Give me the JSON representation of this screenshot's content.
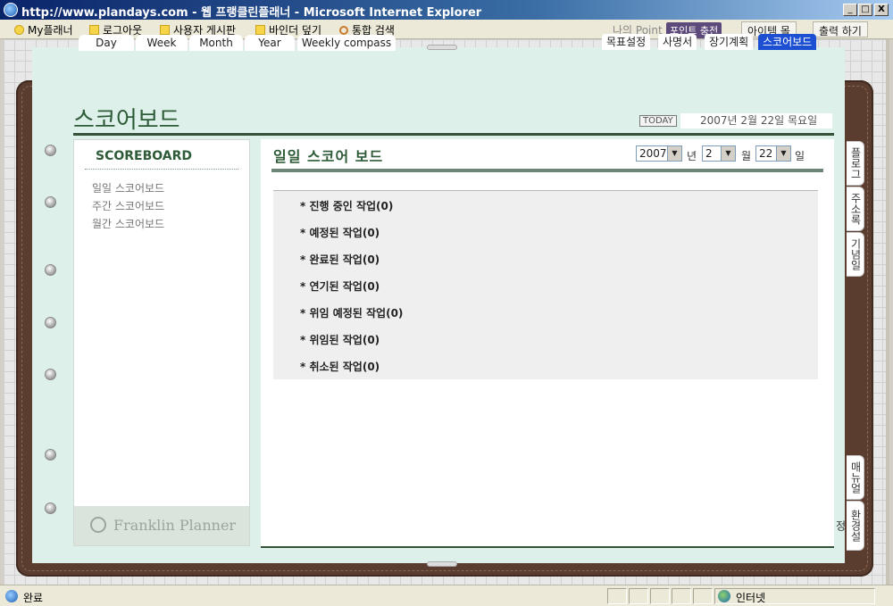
{
  "window": {
    "title": "http://www.plandays.com - 웹 프랭클린플래너 - Microsoft Internet Explorer",
    "minimize": "_",
    "maximize": "□",
    "close": "X"
  },
  "linkbar": {
    "links": [
      "My플래너",
      "로그아웃",
      "사용자 게시판",
      "바인더 덮기",
      "통합 검색"
    ],
    "point_label": "나의 Point",
    "point_charge": "포인트 충전",
    "item_mall": "아이템 몰",
    "print": "출력 하기"
  },
  "top_tabs": [
    "Day",
    "Week",
    "Month",
    "Year",
    "Weekly compass"
  ],
  "right_tabs": [
    "목표설정",
    "사명서",
    "장기계획",
    "스코어보드"
  ],
  "active_right_tab": "스코어보드",
  "header": {
    "page_title": "스코어보드",
    "today_label": "TODAY",
    "today_date": "2007년 2월 22일 목요일"
  },
  "left_panel": {
    "heading": "SCOREBOARD",
    "menu": [
      "일일 스코어보드",
      "주간 스코어보드",
      "월간 스코어보드"
    ],
    "footer_logo": "Franklin Planner"
  },
  "main": {
    "heading": "일일 스코어 보드",
    "year": "2007",
    "year_unit": "년",
    "month": "2",
    "month_unit": "월",
    "day": "22",
    "day_unit": "일",
    "tasks": [
      "진행 중인 작업(0)",
      "예정된 작업(0)",
      "완료된 작업(0)",
      "연기된 작업(0)",
      "위임 예정된 작업(0)",
      "위임된 작업(0)",
      "취소된 작업(0)"
    ]
  },
  "side_tabs": [
    "플로그",
    "주소록",
    "기념일",
    "매뉴얼",
    "환경설정"
  ],
  "statusbar": {
    "status": "완료",
    "zone": "인터넷"
  }
}
